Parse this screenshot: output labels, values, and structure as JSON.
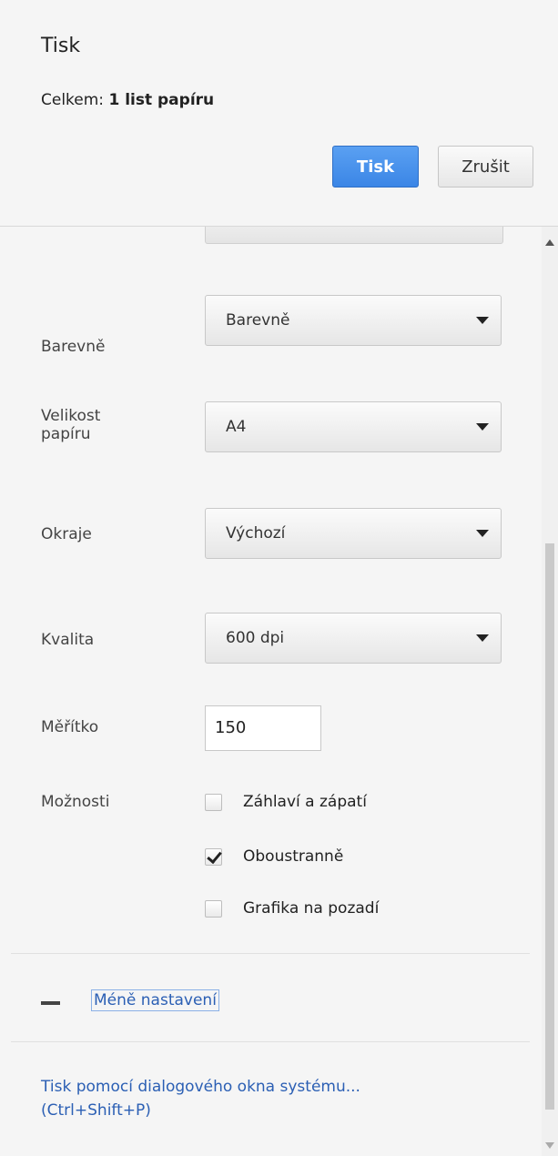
{
  "header": {
    "title": "Tisk",
    "summary_prefix": "Celkem: ",
    "summary_value": "1 list papíru",
    "print_button": "Tisk",
    "cancel_button": "Zrušit"
  },
  "settings": {
    "color": {
      "label": "Barevně",
      "value": "Barevně"
    },
    "paper_size": {
      "label_line1": "Velikost",
      "label_line2": "papíru",
      "value": "A4"
    },
    "margins": {
      "label": "Okraje",
      "value": "Výchozí"
    },
    "quality": {
      "label": "Kvalita",
      "value": "600 dpi"
    },
    "scale": {
      "label": "Měřítko",
      "value": "150"
    },
    "options": {
      "label": "Možnosti",
      "items": [
        {
          "label": "Záhlaví a zápatí",
          "checked": false
        },
        {
          "label": "Oboustranně",
          "checked": true
        },
        {
          "label": "Grafika na pozadí",
          "checked": false
        }
      ]
    }
  },
  "footer": {
    "less_settings": "Méně nastavení",
    "system_dialog_line1": "Tisk pomocí dialogového okna systému...",
    "system_dialog_line2": "(Ctrl+Shift+P)"
  },
  "colors": {
    "primary_button": "#3b86e6",
    "link": "#2b5fb4"
  }
}
